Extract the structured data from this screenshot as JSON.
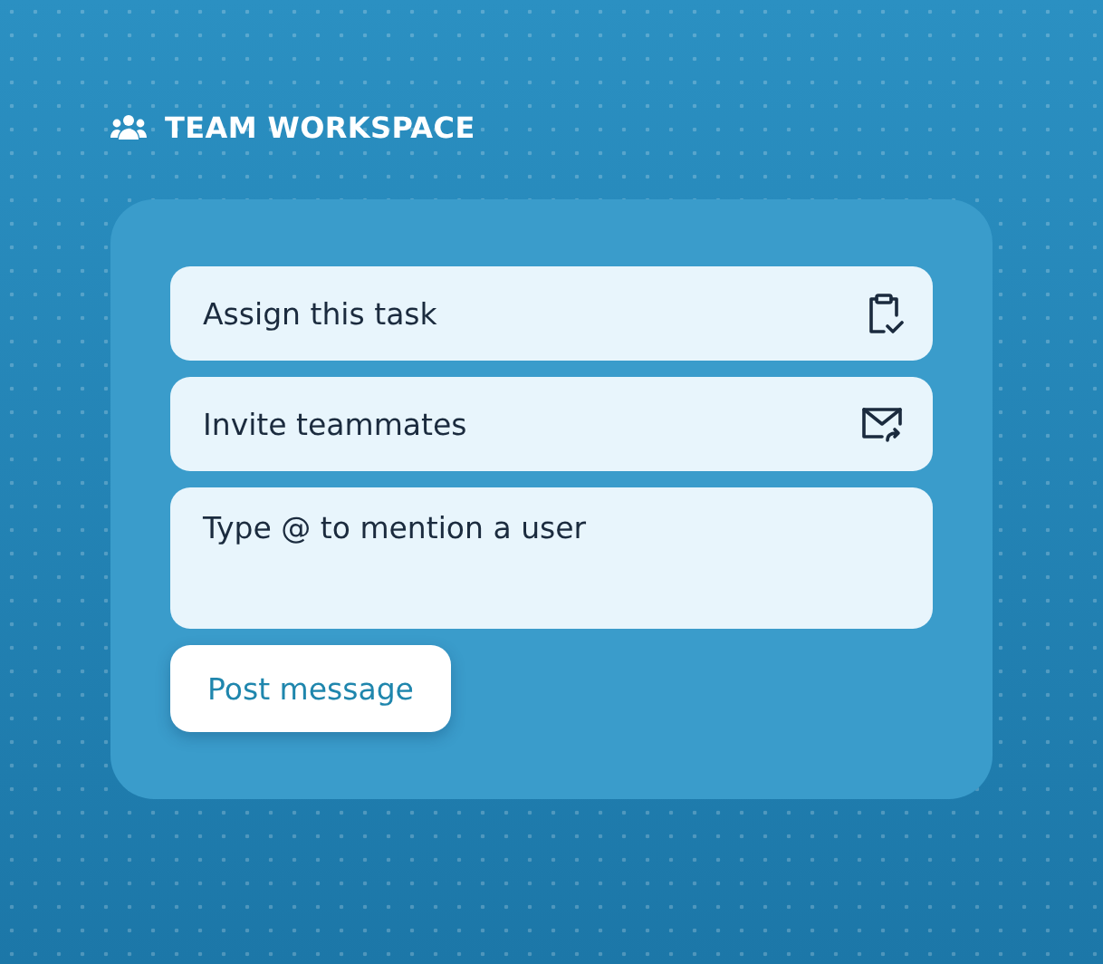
{
  "header": {
    "title": "TEAM WORKSPACE"
  },
  "actions": [
    {
      "label": "Assign this task",
      "kind": "task"
    },
    {
      "label": "Invite teammates",
      "kind": "invite"
    }
  ],
  "message": {
    "placeholder": "Type @ to mention a user"
  },
  "submit": {
    "label": "Post message"
  }
}
